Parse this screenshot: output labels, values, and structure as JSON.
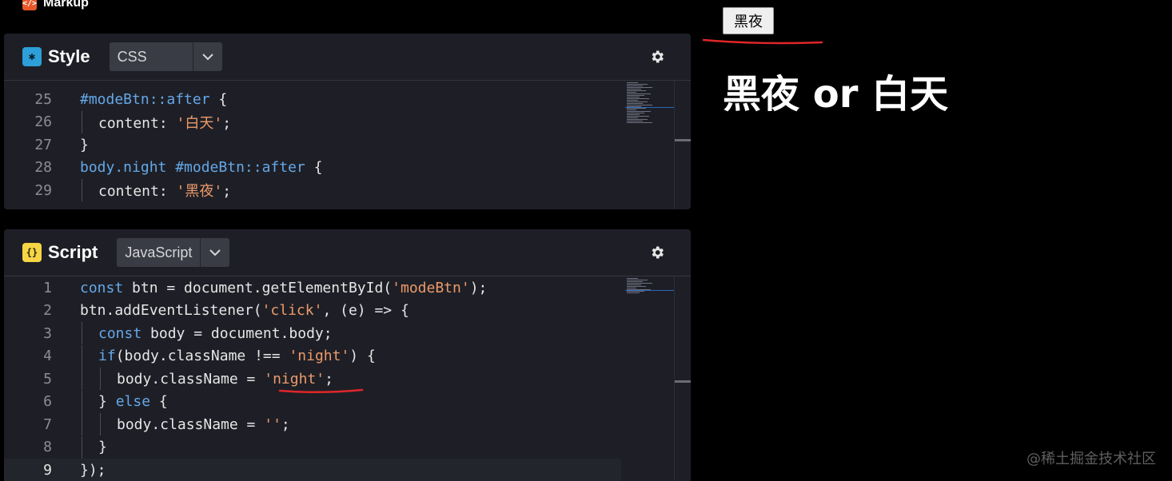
{
  "markup": {
    "label": "Markup",
    "icon": "html-tag-icon"
  },
  "style_panel": {
    "title": "Style",
    "language": "CSS",
    "icon": "css-asterisk-icon",
    "lines": [
      {
        "num": "25",
        "indent": 0,
        "tokens": [
          {
            "t": "#modeBtn::after",
            "c": "k"
          },
          {
            "t": " {",
            "c": "p"
          }
        ]
      },
      {
        "num": "26",
        "indent": 1,
        "tokens": [
          {
            "t": "content",
            "c": "pl"
          },
          {
            "t": ": ",
            "c": "p"
          },
          {
            "t": "'白天'",
            "c": "s"
          },
          {
            "t": ";",
            "c": "p"
          }
        ]
      },
      {
        "num": "27",
        "indent": 0,
        "tokens": [
          {
            "t": "}",
            "c": "p"
          }
        ]
      },
      {
        "num": "28",
        "indent": 0,
        "tokens": [
          {
            "t": "body.night #modeBtn::after",
            "c": "k"
          },
          {
            "t": " {",
            "c": "p"
          }
        ]
      },
      {
        "num": "29",
        "indent": 1,
        "tokens": [
          {
            "t": "content",
            "c": "pl"
          },
          {
            "t": ": ",
            "c": "p"
          },
          {
            "t": "'黑夜'",
            "c": "s"
          },
          {
            "t": ";",
            "c": "p"
          }
        ]
      }
    ]
  },
  "script_panel": {
    "title": "Script",
    "language": "JavaScript",
    "icon": "js-braces-icon",
    "lines": [
      {
        "num": "1",
        "indent": 0,
        "tokens": [
          {
            "t": "const",
            "c": "k"
          },
          {
            "t": " btn = document.getElementById(",
            "c": "p"
          },
          {
            "t": "'modeBtn'",
            "c": "s"
          },
          {
            "t": ");",
            "c": "p"
          }
        ]
      },
      {
        "num": "2",
        "indent": 0,
        "tokens": [
          {
            "t": "btn.addEventListener(",
            "c": "p"
          },
          {
            "t": "'click'",
            "c": "s"
          },
          {
            "t": ", (e) => {",
            "c": "p"
          }
        ]
      },
      {
        "num": "3",
        "indent": 1,
        "tokens": [
          {
            "t": "const",
            "c": "k"
          },
          {
            "t": " body = document.body;",
            "c": "p"
          }
        ]
      },
      {
        "num": "4",
        "indent": 1,
        "tokens": [
          {
            "t": "if",
            "c": "k"
          },
          {
            "t": "(body.className !== ",
            "c": "p"
          },
          {
            "t": "'night'",
            "c": "s"
          },
          {
            "t": ") {",
            "c": "p"
          }
        ]
      },
      {
        "num": "5",
        "indent": 2,
        "tokens": [
          {
            "t": "body.className = ",
            "c": "p"
          },
          {
            "t": "'night'",
            "c": "s"
          },
          {
            "t": ";",
            "c": "p"
          }
        ]
      },
      {
        "num": "6",
        "indent": 1,
        "tokens": [
          {
            "t": "} ",
            "c": "p"
          },
          {
            "t": "else",
            "c": "k"
          },
          {
            "t": " {",
            "c": "p"
          }
        ]
      },
      {
        "num": "7",
        "indent": 2,
        "tokens": [
          {
            "t": "body.className = ",
            "c": "p"
          },
          {
            "t": "''",
            "c": "s"
          },
          {
            "t": ";",
            "c": "p"
          }
        ]
      },
      {
        "num": "8",
        "indent": 1,
        "tokens": [
          {
            "t": "}",
            "c": "p"
          }
        ]
      },
      {
        "num": "9",
        "indent": 0,
        "active": true,
        "tokens": [
          {
            "t": "});",
            "c": "p"
          }
        ]
      }
    ]
  },
  "preview": {
    "button_label": "黑夜",
    "heading": "黑夜 or 白天"
  },
  "watermark": "@稀土掘金技术社区",
  "colors": {
    "background": "#000000",
    "panel": "#1e1f26",
    "keyword": "#64a8e8",
    "string": "#ec9a6a",
    "annotation": "#e0262a"
  }
}
